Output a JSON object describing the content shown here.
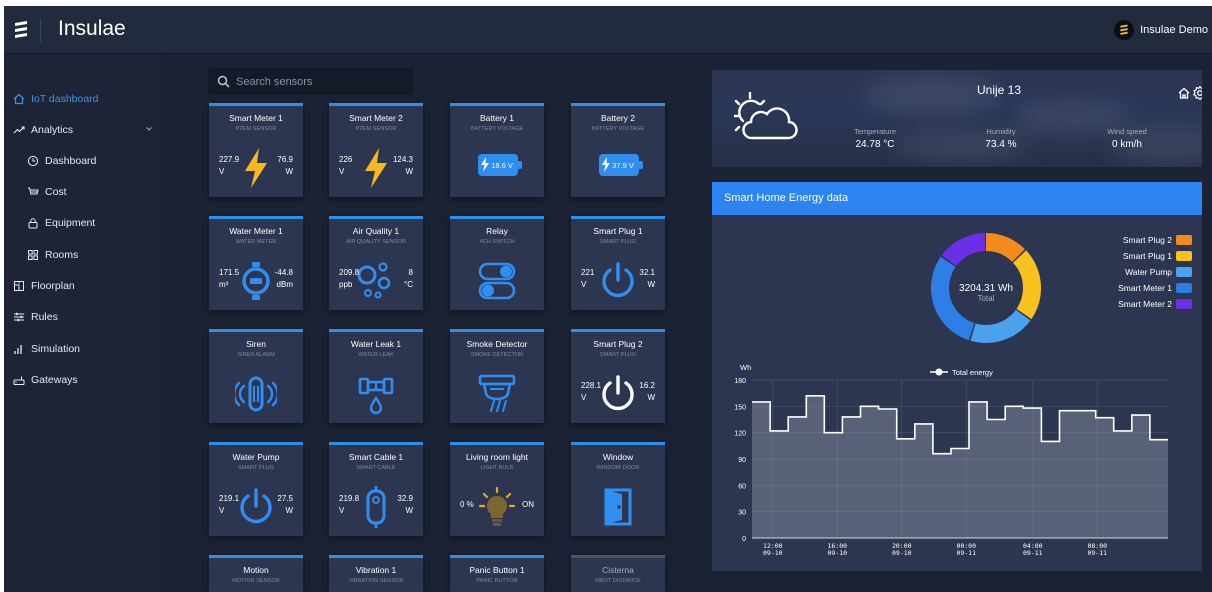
{
  "app": {
    "name": "Insulae",
    "user": "Insulae Demo"
  },
  "sidebar": {
    "items": [
      {
        "label": "IoT dashboard",
        "icon": "home-icon",
        "active": true
      },
      {
        "label": "Analytics",
        "icon": "trend-icon",
        "expandable": true
      },
      {
        "label": "Dashboard",
        "icon": "clock-icon",
        "sub": true
      },
      {
        "label": "Cost",
        "icon": "cart-icon",
        "sub": true
      },
      {
        "label": "Equipment",
        "icon": "lock-icon",
        "sub": true
      },
      {
        "label": "Rooms",
        "icon": "grid-icon",
        "sub": true
      },
      {
        "label": "Floorplan",
        "icon": "floorplan-icon"
      },
      {
        "label": "Rules",
        "icon": "sliders-icon"
      },
      {
        "label": "Simulation",
        "icon": "bars-icon"
      },
      {
        "label": "Gateways",
        "icon": "router-icon"
      }
    ]
  },
  "search": {
    "placeholder": "Search sensors"
  },
  "sensors": [
    {
      "title": "Smart Meter 1",
      "subtitle": "PZEM SENSOR",
      "icon": "lightning-icon",
      "left1": "227.9",
      "left2": "V",
      "right1": "76.9",
      "right2": "W"
    },
    {
      "title": "Smart Meter 2",
      "subtitle": "PZEM SENSOR",
      "icon": "lightning-icon",
      "left1": "226",
      "left2": "V",
      "right1": "124.3",
      "right2": "W"
    },
    {
      "title": "Battery 1",
      "subtitle": "BATTERY VOLTAGE",
      "icon": "battery-icon",
      "value": "18.6 V"
    },
    {
      "title": "Battery 2",
      "subtitle": "BATTERY VOLTAGE",
      "icon": "battery-icon",
      "value": "37.9 V"
    },
    {
      "title": "Water Meter 1",
      "subtitle": "WATER METER",
      "icon": "water-meter-icon",
      "left1": "171.5",
      "left2": "m³",
      "right1": "-44.8",
      "right2": "dBm"
    },
    {
      "title": "Air Quality 1",
      "subtitle": "AIR QUALITY SENSOR",
      "icon": "bubbles-icon",
      "left1": "209.8",
      "left2": "ppb",
      "right1": "8",
      "right2": "°C"
    },
    {
      "title": "Relay",
      "subtitle": "4CH SWITCH",
      "icon": "relay-toggle-icon"
    },
    {
      "title": "Smart Plug 1",
      "subtitle": "SMART PLUG",
      "icon": "power-icon",
      "left1": "221",
      "left2": "V",
      "right1": "32.1",
      "right2": "W"
    },
    {
      "title": "Siren",
      "subtitle": "SIREN ALARM",
      "icon": "siren-icon"
    },
    {
      "title": "Water Leak 1",
      "subtitle": "WATER LEAK",
      "icon": "water-leak-icon"
    },
    {
      "title": "Smoke Detector",
      "subtitle": "SMOKE DETECTOR",
      "icon": "smoke-detector-icon"
    },
    {
      "title": "Smart Plug 2",
      "subtitle": "SMART PLUG",
      "icon": "power-icon",
      "left1": "228.1",
      "left2": "V",
      "right1": "16.2",
      "right2": "W"
    },
    {
      "title": "Water Pump",
      "subtitle": "SMART PLUG",
      "icon": "power-icon",
      "left1": "219.1",
      "left2": "V",
      "right1": "27.5",
      "right2": "W"
    },
    {
      "title": "Smart Cable 1",
      "subtitle": "SMART CABLE",
      "icon": "cable-icon",
      "left1": "219.8",
      "left2": "V",
      "right1": "32.9",
      "right2": "W"
    },
    {
      "title": "Living room light",
      "subtitle": "LIGHT BULB",
      "icon": "light-bulb-icon",
      "left1": "0 %",
      "right1": "ON"
    },
    {
      "title": "Window",
      "subtitle": "WINDOW DOOR",
      "icon": "door-icon"
    },
    {
      "title": "Motion",
      "subtitle": "MOTION SENSOR",
      "icon": "motion-icon"
    },
    {
      "title": "Vibration 1",
      "subtitle": "VIBRATION SENSOR",
      "icon": "vibration-icon"
    },
    {
      "title": "Panic Button 1",
      "subtitle": "PANIC BUTTON",
      "icon": "panic-icon"
    },
    {
      "title": "Cisterna",
      "subtitle": "MBoT DISTANCE",
      "icon": "distance-icon",
      "dim": true
    }
  ],
  "weather": {
    "location": "Unije 13",
    "icon": "sun-cloud-icon",
    "stats": [
      {
        "label": "Temperature",
        "value": "24.78 °C"
      },
      {
        "label": "Humidity",
        "value": "73.4 %"
      },
      {
        "label": "Wind speed",
        "value": "0 km/h"
      }
    ]
  },
  "energy": {
    "title": "Smart Home Energy data",
    "total_value": "3204.31 Wh",
    "total_label": "Total",
    "colors": {
      "accent": "#2b84f0",
      "panel": "#2d3650"
    }
  },
  "chart_data": [
    {
      "type": "pie",
      "title": "",
      "center_value": "3204.31 Wh",
      "center_label": "Total",
      "series": [
        {
          "name": "Smart Plug 2",
          "color": "#f38b1b",
          "value": 0.13
        },
        {
          "name": "Smart Plug 1",
          "color": "#f8c21e",
          "value": 0.22
        },
        {
          "name": "Water Pump",
          "color": "#4aa2ee",
          "value": 0.2
        },
        {
          "name": "Smart Meter 1",
          "color": "#2f7ee6",
          "value": 0.3
        },
        {
          "name": "Smart Meter 2",
          "color": "#6a2fe6",
          "value": 0.15
        }
      ]
    },
    {
      "type": "area",
      "title": "",
      "ylabel": "Wh",
      "legend": "Total energy",
      "ylim": [
        0,
        180
      ],
      "yticks": [
        0,
        30,
        60,
        90,
        120,
        150,
        180
      ],
      "xticks": [
        {
          "time": "12:00",
          "date": "09-10",
          "pos": 0.05
        },
        {
          "time": "16:00",
          "date": "09-10",
          "pos": 0.205
        },
        {
          "time": "20:00",
          "date": "09-10",
          "pos": 0.36
        },
        {
          "time": "00:00",
          "date": "09-11",
          "pos": 0.515
        },
        {
          "time": "04:00",
          "date": "09-11",
          "pos": 0.675
        },
        {
          "time": "08:00",
          "date": "09-11",
          "pos": 0.83
        }
      ],
      "values": [
        155,
        122,
        138,
        162,
        120,
        138,
        150,
        147,
        113,
        130,
        96,
        102,
        155,
        135,
        150,
        148,
        110,
        145,
        145,
        137,
        122,
        140,
        112
      ],
      "grid": true
    }
  ]
}
